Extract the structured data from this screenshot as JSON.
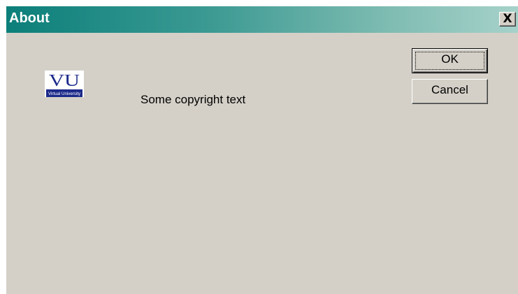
{
  "window": {
    "title": "About",
    "close_label": "X"
  },
  "logo": {
    "text": "VU",
    "subtext": "Virtual University",
    "color": "#1c2a8a"
  },
  "content": {
    "copyright": "Some copyright text"
  },
  "buttons": {
    "ok_label": "OK",
    "cancel_label": "Cancel"
  },
  "colors": {
    "dialog_bg": "#d4d0c8",
    "titlebar_start": "#0c7f7a",
    "titlebar_end": "#a6d2ca"
  }
}
